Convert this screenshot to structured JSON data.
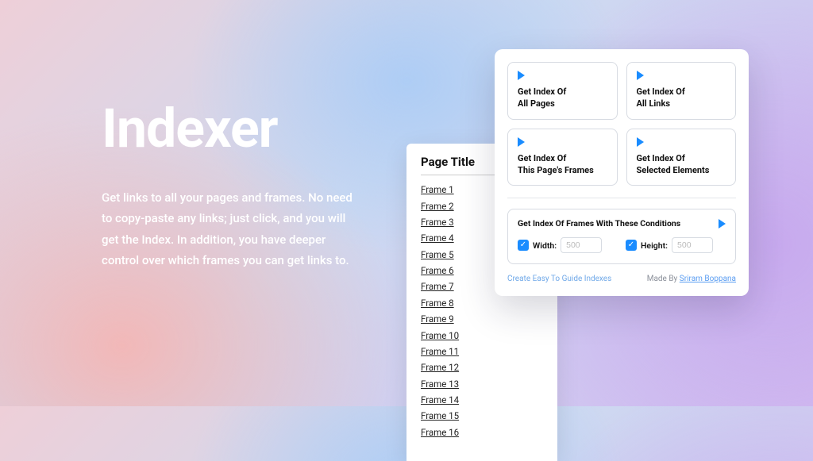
{
  "hero": {
    "title": "Indexer",
    "subtitle": "Get links to all your pages and frames. No need to copy-paste any links; just click, and you will get the Index. In addition, you have deeper control over which frames you can get links to."
  },
  "frame_panel": {
    "heading": "Page Title",
    "items": [
      "Frame 1",
      "Frame 2",
      "Frame 3",
      "Frame 4",
      "Frame 5",
      "Frame 6",
      "Frame 7",
      "Frame 8",
      "Frame 9",
      "Frame 10",
      "Frame 11",
      "Frame 12",
      "Frame 13",
      "Frame 14",
      "Frame 15",
      "Frame 16"
    ]
  },
  "actions": [
    {
      "line1": "Get Index Of",
      "line2": "All Pages"
    },
    {
      "line1": "Get Index Of",
      "line2": "All Links"
    },
    {
      "line1": "Get Index Of",
      "line2": "This Page's Frames"
    },
    {
      "line1": "Get Index Of",
      "line2": "Selected Elements"
    }
  ],
  "conditions": {
    "title": "Get Index Of Frames With These Conditions",
    "width_label": "Width:",
    "width_placeholder": "500",
    "height_label": "Height:",
    "height_placeholder": "500"
  },
  "footer": {
    "tagline": "Create Easy To Guide Indexes",
    "made_by_prefix": "Made By ",
    "author": "Sriram Boppana"
  },
  "colors": {
    "accent": "#1a8cff"
  }
}
